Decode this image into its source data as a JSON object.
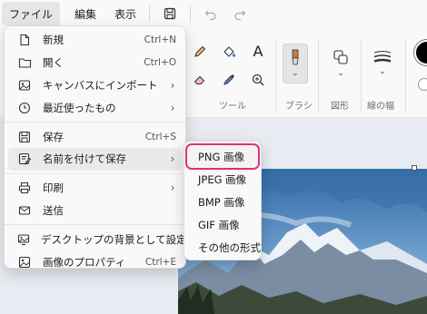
{
  "menubar": {
    "file": "ファイル",
    "edit": "編集",
    "view": "表示",
    "icons": [
      "save-icon",
      "undo-icon",
      "redo-icon"
    ]
  },
  "ribbon": {
    "tools_label": "ツール",
    "brush_label": "ブラシ",
    "shapes_label": "図形",
    "stroke_label": "線の幅",
    "text_tool": "A"
  },
  "file_menu": {
    "items": [
      {
        "label": "新規",
        "shortcut": "Ctrl+N",
        "icon": "new-file-icon"
      },
      {
        "label": "開く",
        "shortcut": "Ctrl+O",
        "icon": "folder-icon"
      },
      {
        "label": "キャンバスにインポート",
        "submenu": true,
        "icon": "import-icon"
      },
      {
        "label": "最近使ったもの",
        "submenu": true,
        "icon": "clock-icon"
      },
      {
        "label": "保存",
        "shortcut": "Ctrl+S",
        "icon": "save-icon"
      },
      {
        "label": "名前を付けて保存",
        "submenu": true,
        "icon": "save-as-icon"
      },
      {
        "label": "印刷",
        "submenu": true,
        "icon": "printer-icon"
      },
      {
        "label": "送信",
        "icon": "send-icon"
      },
      {
        "label": "デスクトップの背景として設定",
        "submenu": true,
        "icon": "desktop-icon"
      },
      {
        "label": "画像のプロパティ",
        "shortcut": "Ctrl+E",
        "icon": "properties-icon"
      }
    ]
  },
  "save_as_menu": {
    "items": [
      "PNG 画像",
      "JPEG 画像",
      "BMP 画像",
      "GIF 画像",
      "その他の形式"
    ],
    "selected": "PNG 画像",
    "highlight_color": "#e0307a"
  }
}
